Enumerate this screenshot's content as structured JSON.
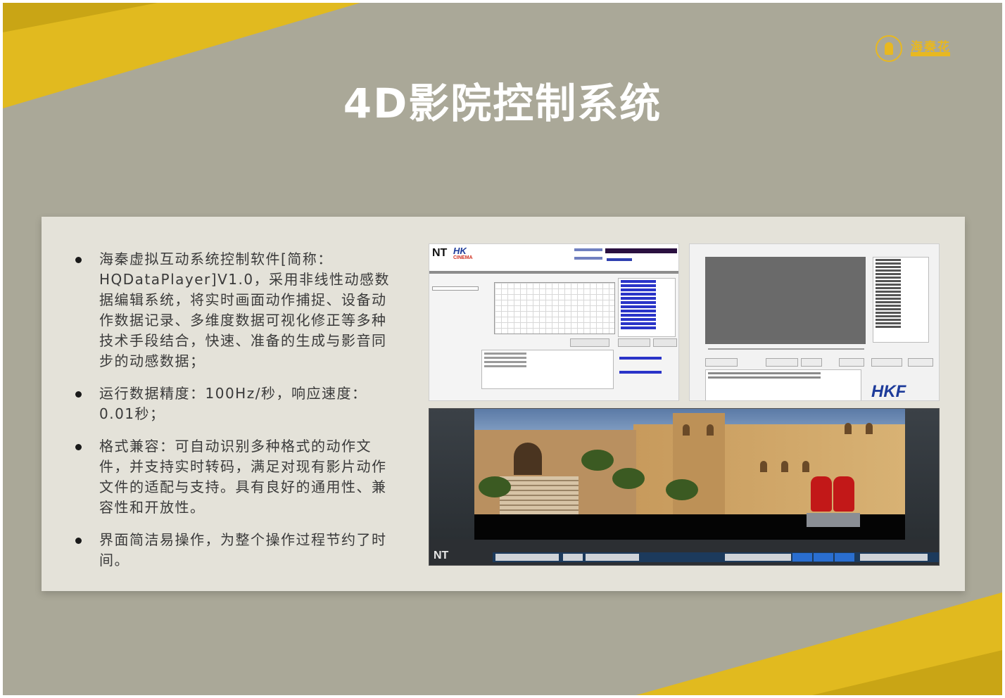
{
  "brand": {
    "logo_text": "海秦花",
    "accent_color": "#e8b820",
    "background_color": "#aaa898",
    "panel_color": "#e4e2d9"
  },
  "slide": {
    "title": "4D影院控制系统"
  },
  "bullets": [
    "海秦虚拟互动系统控制软件[简称：HQDataPlayer]V1.0，采用非线性动感数据编辑系统，将实时画面动作捕捉、设备动作数据记录、多维度数据可视化修正等多种技术手段结合，快速、准备的生成与影音同步的动感数据；",
    "运行数据精度：100Hz/秒，响应速度：0.01秒；",
    "格式兼容：可自动识别多种格式的动作文件，并支持实时转码，满足对现有影片动作文件的适配与支持。具有良好的通用性、兼容性和开放性。",
    "界面简洁易操作，为整个操作过程节约了时间。"
  ],
  "screenshots": {
    "shot1": {
      "logo_nt": "NT",
      "logo_hk": "HK",
      "logo_cinema": "CINEMA"
    },
    "shot2": {
      "logo_hk": "HKF"
    },
    "shot3": {
      "logo_nt": "NT"
    }
  }
}
